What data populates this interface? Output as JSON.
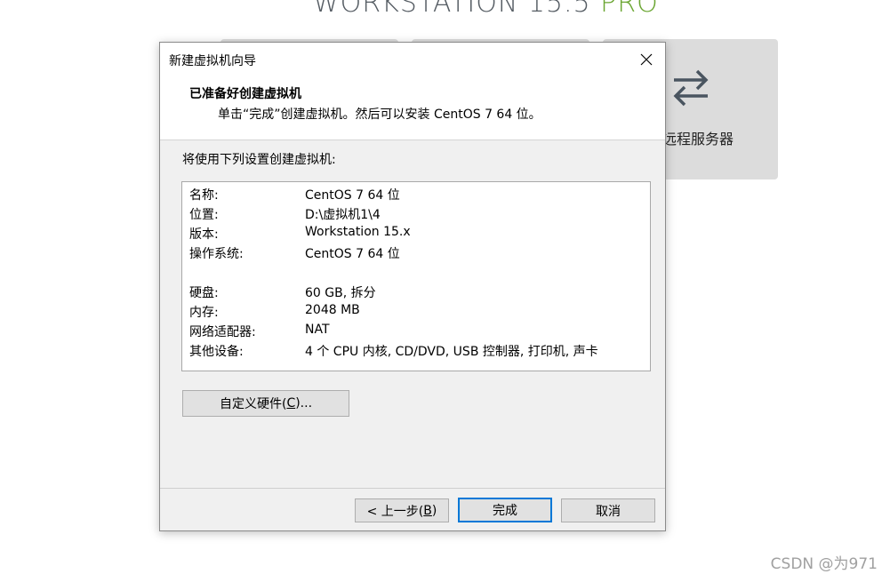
{
  "background": {
    "brand_main": "WORKSTATION",
    "brand_version": "15.5",
    "brand_edition": "PRO",
    "tile_label": "远程服务器",
    "watermark": "CSDN @为971"
  },
  "dialog": {
    "title": "新建虚拟机向导",
    "header_title": "已准备好创建虚拟机",
    "header_subtitle": "单击“完成”创建虚拟机。然后可以安装 CentOS 7 64 位。",
    "intro": "将使用下列设置创建虚拟机:",
    "summary": [
      {
        "label": "名称:",
        "value": "CentOS 7 64 位"
      },
      {
        "label": "位置:",
        "value": "D:\\虚拟机1\\4"
      },
      {
        "label": "版本:",
        "value": "Workstation 15.x"
      },
      {
        "label": "操作系统:",
        "value": "CentOS 7 64 位"
      },
      {
        "label": "硬盘:",
        "value": "60 GB, 拆分"
      },
      {
        "label": "内存:",
        "value": "2048 MB"
      },
      {
        "label": "网络适配器:",
        "value": "NAT"
      },
      {
        "label": "其他设备:",
        "value": "4 个 CPU 内核, CD/DVD, USB 控制器, 打印机, 声卡"
      }
    ],
    "customize_prefix": "自定义硬件(",
    "customize_key": "C",
    "customize_suffix": ")...",
    "back_prefix": "< 上一步(",
    "back_key": "B",
    "back_suffix": ")",
    "finish_label": "完成",
    "cancel_label": "取消"
  },
  "colors": {
    "brand_pro": "#6aa531",
    "primary_border": "#0078d7"
  }
}
